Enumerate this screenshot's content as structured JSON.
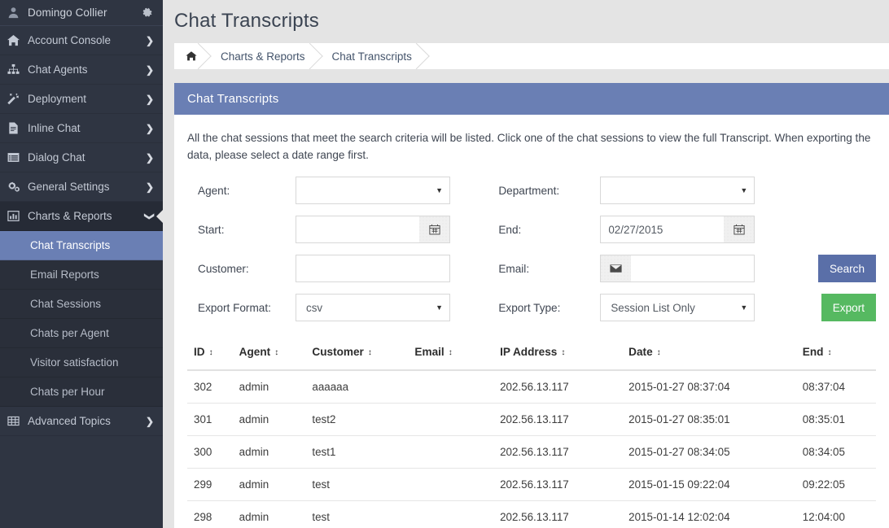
{
  "sidebar": {
    "user": {
      "name": "Domingo Collier",
      "user_icon": "user-icon",
      "gear_icon": "gear-icon"
    },
    "items": [
      {
        "label": "Account Console",
        "icon": "home-icon",
        "caret": "❯"
      },
      {
        "label": "Chat Agents",
        "icon": "sitemap-icon",
        "caret": "❯"
      },
      {
        "label": "Deployment",
        "icon": "magic-wand-icon",
        "caret": "❯"
      },
      {
        "label": "Inline Chat",
        "icon": "file-text-icon",
        "caret": "❯"
      },
      {
        "label": "Dialog Chat",
        "icon": "window-list-icon",
        "caret": "❯"
      },
      {
        "label": "General Settings",
        "icon": "gears-icon",
        "caret": "❯"
      },
      {
        "label": "Charts & Reports",
        "icon": "bar-chart-icon",
        "caret": "❯",
        "active": true
      },
      {
        "label": "Advanced Topics",
        "icon": "table-grid-icon",
        "caret": "❯"
      }
    ],
    "submenu": [
      {
        "label": "Chat Transcripts",
        "active": true
      },
      {
        "label": "Email Reports",
        "active": false
      },
      {
        "label": "Chat Sessions",
        "active": false
      },
      {
        "label": "Chats per Agent",
        "active": false
      },
      {
        "label": "Visitor satisfaction",
        "active": false
      },
      {
        "label": "Chats per Hour",
        "active": false
      }
    ],
    "colors": {
      "bg": "#2f3542",
      "active_sub": "#6a7fb4",
      "active_item": "#262b36"
    }
  },
  "header": {
    "title": "Chat Transcripts",
    "breadcrumb": [
      {
        "label": "",
        "icon": "home-icon"
      },
      {
        "label": "Charts & Reports"
      },
      {
        "label": "Chat Transcripts"
      }
    ]
  },
  "panel": {
    "title": "Chat Transcripts",
    "description": "All the chat sessions that meet the search criteria will be listed. Click one of the chat sessions to view the full Transcript. When exporting the data, please select a date range first.",
    "header_color": "#6a7fb4"
  },
  "form": {
    "agent": {
      "label": "Agent:",
      "value": "",
      "placeholder": ""
    },
    "department": {
      "label": "Department:",
      "value": "",
      "placeholder": ""
    },
    "start": {
      "label": "Start:",
      "value": "",
      "placeholder": "",
      "icon": "calendar-icon"
    },
    "end": {
      "label": "End:",
      "value": "02/27/2015",
      "placeholder": "",
      "icon": "calendar-icon"
    },
    "customer": {
      "label": "Customer:",
      "value": "",
      "placeholder": ""
    },
    "email": {
      "label": "Email:",
      "value": "",
      "placeholder": "",
      "icon": "envelope-icon"
    },
    "export_format": {
      "label": "Export Format:",
      "value": "csv",
      "options": [
        "csv"
      ]
    },
    "export_type": {
      "label": "Export Type:",
      "value": "Session List Only",
      "options": [
        "Session List Only"
      ]
    },
    "search_button": {
      "label": "Search",
      "color": "#5a6fa8"
    },
    "export_button": {
      "label": "Export",
      "color": "#56b961"
    }
  },
  "table": {
    "columns": [
      {
        "label": "ID",
        "sortable": true
      },
      {
        "label": "Agent",
        "sortable": true
      },
      {
        "label": "Customer",
        "sortable": true
      },
      {
        "label": "Email",
        "sortable": true
      },
      {
        "label": "IP Address",
        "sortable": true
      },
      {
        "label": "Date",
        "sortable": true
      },
      {
        "label": "End",
        "sortable": true
      }
    ],
    "sort_icon": "↕",
    "rows": [
      {
        "id": "302",
        "agent": "admin",
        "customer": "aaaaaa",
        "email": "",
        "ip": "202.56.13.117",
        "date": "2015-01-27 08:37:04",
        "end": "08:37:04"
      },
      {
        "id": "301",
        "agent": "admin",
        "customer": "test2",
        "email": "",
        "ip": "202.56.13.117",
        "date": "2015-01-27 08:35:01",
        "end": "08:35:01"
      },
      {
        "id": "300",
        "agent": "admin",
        "customer": "test1",
        "email": "",
        "ip": "202.56.13.117",
        "date": "2015-01-27 08:34:05",
        "end": "08:34:05"
      },
      {
        "id": "299",
        "agent": "admin",
        "customer": "test",
        "email": "",
        "ip": "202.56.13.117",
        "date": "2015-01-15 09:22:04",
        "end": "09:22:05"
      },
      {
        "id": "298",
        "agent": "admin",
        "customer": "test",
        "email": "",
        "ip": "202.56.13.117",
        "date": "2015-01-14 12:02:04",
        "end": "12:04:00"
      }
    ]
  }
}
